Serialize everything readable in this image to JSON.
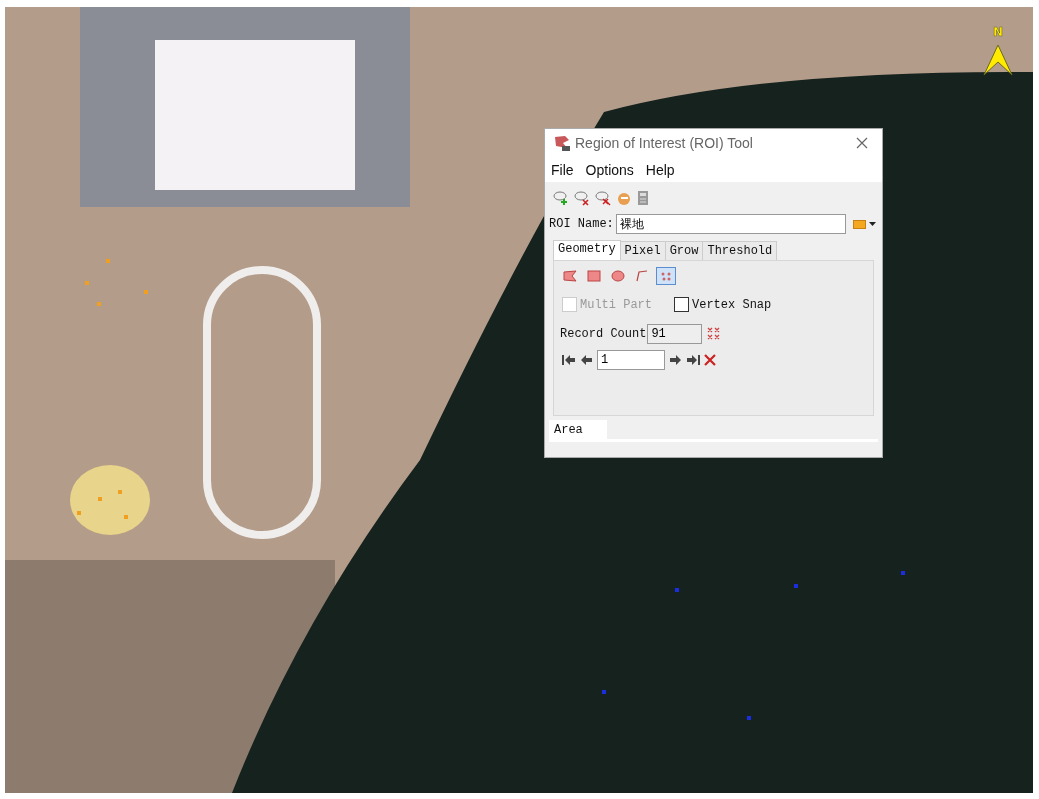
{
  "map": {
    "north_label": "N"
  },
  "window": {
    "title": "Region of Interest (ROI) Tool"
  },
  "menu": [
    "File",
    "Options",
    "Help"
  ],
  "roi_name": {
    "label": "ROI Name:",
    "value": "裸地"
  },
  "tabs": [
    {
      "label": "Geometry",
      "selected": true
    },
    {
      "label": "Pixel",
      "selected": false
    },
    {
      "label": "Grow",
      "selected": false
    },
    {
      "label": "Threshold",
      "selected": false
    }
  ],
  "geometry_tools": [
    {
      "kind": "polygon",
      "selected": false
    },
    {
      "kind": "rectangle",
      "selected": false
    },
    {
      "kind": "ellipse",
      "selected": false
    },
    {
      "kind": "polyline",
      "selected": false
    },
    {
      "kind": "point",
      "selected": true
    }
  ],
  "options": [
    {
      "label": "Multi Part",
      "checked": false,
      "disabled": true
    },
    {
      "label": "Vertex Snap",
      "checked": false,
      "disabled": false
    }
  ],
  "record_count": {
    "label": "Record Count",
    "value": "91"
  },
  "record_nav": {
    "value": "1"
  },
  "bottom_tabs": [
    {
      "label": "Area",
      "selected": true
    }
  ]
}
